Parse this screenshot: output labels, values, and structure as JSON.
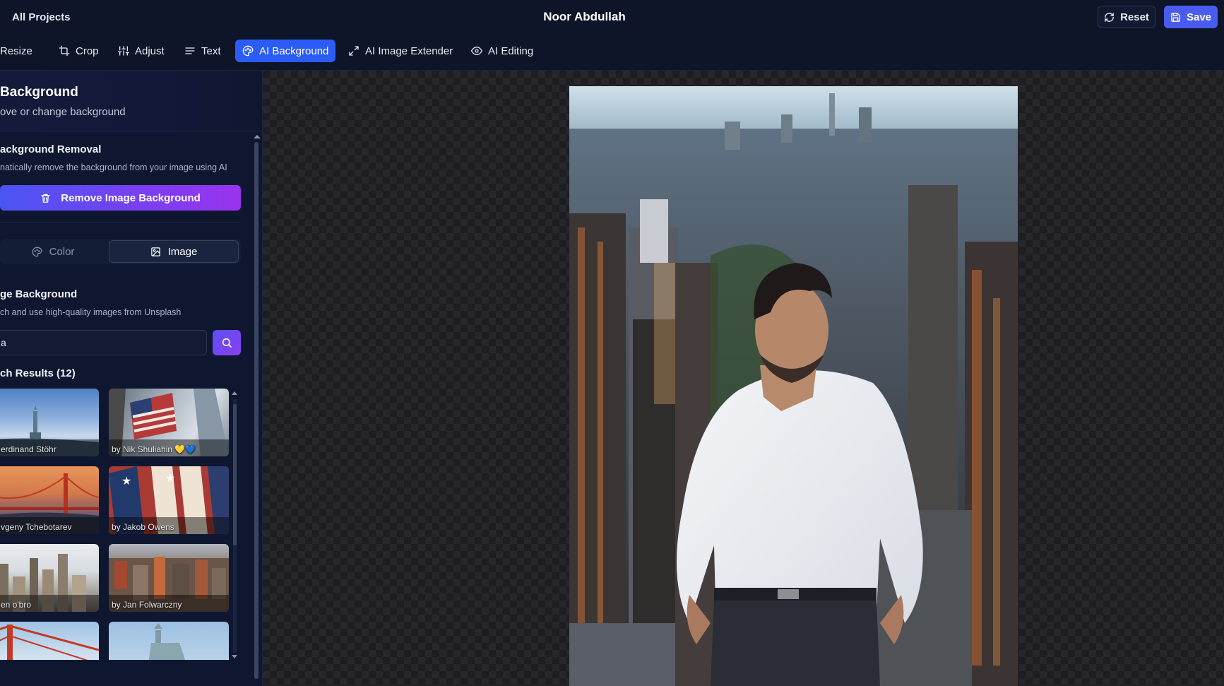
{
  "header": {
    "back_label": "All Projects",
    "project_title": "Noor Abdullah",
    "reset_label": "Reset",
    "save_label": "Save"
  },
  "toolbar": {
    "tools": [
      {
        "label": "Resize",
        "icon": "resize-icon"
      },
      {
        "label": "Crop",
        "icon": "crop-icon"
      },
      {
        "label": "Adjust",
        "icon": "sliders-icon"
      },
      {
        "label": "Text",
        "icon": "text-icon"
      },
      {
        "label": "AI Background",
        "icon": "palette-icon",
        "active": true
      },
      {
        "label": "AI Image Extender",
        "icon": "expand-icon"
      },
      {
        "label": "AI Editing",
        "icon": "eye-icon"
      }
    ]
  },
  "sidebar": {
    "title": "Background",
    "subtitle": "ove or change background",
    "removal": {
      "title": "ackground Removal",
      "description": "natically remove the background from your image using AI",
      "button_label": "Remove Image Background"
    },
    "mode_toggle": {
      "options": [
        "Color",
        "Image"
      ],
      "selected": "Image"
    },
    "image_background": {
      "title": "ge Background",
      "description": "ch and use high-quality images from Unsplash",
      "search_value": "a",
      "results_label": "ch Results (12)",
      "results": [
        {
          "credit": "erdinand Stöhr"
        },
        {
          "credit": "by Nik Shuliahin 💛💙"
        },
        {
          "credit": "vgeny Tchebotarev"
        },
        {
          "credit": "by Jakob Owens"
        },
        {
          "credit": "en o'bro"
        },
        {
          "credit": "by Jan Folwarczny"
        },
        {
          "credit": ""
        },
        {
          "credit": ""
        }
      ]
    }
  },
  "colors": {
    "accent": "#2b5cf5",
    "save": "#4a5cf0",
    "gradient_start": "#4a55f2",
    "gradient_end": "#9a33ee"
  }
}
